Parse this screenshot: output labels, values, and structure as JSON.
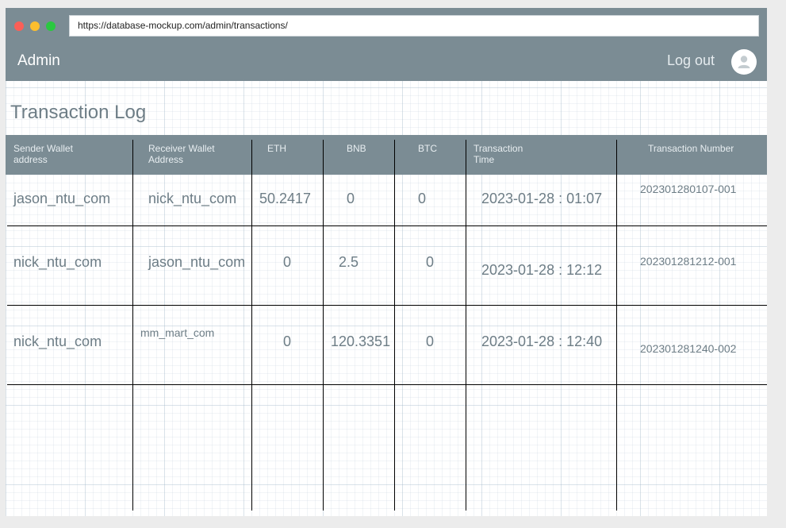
{
  "browser": {
    "url": "https://database-mockup.com/admin/transactions/"
  },
  "navbar": {
    "brand": "Admin",
    "logout_label": "Log out",
    "avatar_icon": "user-icon"
  },
  "page": {
    "title": "Transaction Log"
  },
  "table": {
    "headers": {
      "sender": "Sender Wallet\naddress",
      "receiver": "Receiver Wallet\nAddress",
      "eth": "ETH",
      "bnb": "BNB",
      "btc": "BTC",
      "time": "Transaction\nTime",
      "number": "Transaction Number"
    },
    "rows": [
      {
        "sender": "jason_ntu_com",
        "receiver": "nick_ntu_com",
        "eth": "50.2417",
        "bnb": "0",
        "btc": "0",
        "time": "2023-01-28 : 01:07",
        "number": "202301280107-001"
      },
      {
        "sender": "nick_ntu_com",
        "receiver": "jason_ntu_com",
        "eth": "0",
        "bnb": "2.5",
        "btc": "0",
        "time": "2023-01-28 : 12:12",
        "number": "202301281212-001"
      },
      {
        "sender": "nick_ntu_com",
        "receiver": "mm_mart_com",
        "eth": "0",
        "bnb": "120.3351",
        "btc": "0",
        "time": "2023-01-28 : 12:40",
        "number": "202301281240-002"
      }
    ]
  },
  "colors": {
    "header_bg": "#7b8c94",
    "text": "#6d7d86",
    "window_close": "#fb5f57",
    "window_minimize": "#fcbe2e",
    "window_maximize": "#2ac840"
  }
}
